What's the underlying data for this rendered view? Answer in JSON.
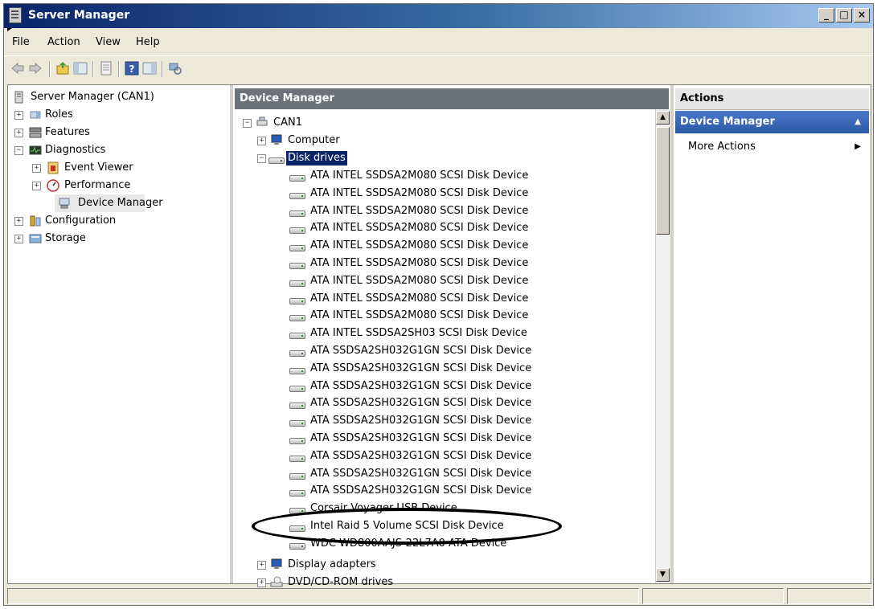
{
  "window": {
    "title": "Server Manager",
    "controls": [
      "_",
      "□",
      "×"
    ]
  },
  "menu": [
    "File",
    "Action",
    "View",
    "Help"
  ],
  "toolbar_icons": [
    "back-icon",
    "forward-icon",
    "up-folder-icon",
    "show-hide-tree-icon",
    "properties-icon",
    "help-icon",
    "show-hide-action-pane-icon",
    "scan-hardware-icon"
  ],
  "left_tree": {
    "root": "Server Manager (CAN1)",
    "items": [
      {
        "label": "Roles",
        "expander": "+"
      },
      {
        "label": "Features",
        "expander": "+"
      },
      {
        "label": "Diagnostics",
        "expander": "−"
      },
      {
        "label": "Event Viewer",
        "expander": "+"
      },
      {
        "label": "Performance",
        "expander": "+"
      },
      {
        "label": "Device Manager",
        "expander": ""
      },
      {
        "label": "Configuration",
        "expander": "+"
      },
      {
        "label": "Storage",
        "expander": "+"
      }
    ]
  },
  "middle": {
    "header": "Device Manager",
    "root": "CAN1",
    "computer": "Computer",
    "disk_drives": "Disk drives",
    "disks": [
      "ATA INTEL SSDSA2M080 SCSI Disk Device",
      "ATA INTEL SSDSA2M080 SCSI Disk Device",
      "ATA INTEL SSDSA2M080 SCSI Disk Device",
      "ATA INTEL SSDSA2M080 SCSI Disk Device",
      "ATA INTEL SSDSA2M080 SCSI Disk Device",
      "ATA INTEL SSDSA2M080 SCSI Disk Device",
      "ATA INTEL SSDSA2M080 SCSI Disk Device",
      "ATA INTEL SSDSA2M080 SCSI Disk Device",
      "ATA INTEL SSDSA2M080 SCSI Disk Device",
      "ATA INTEL SSDSA2SH03 SCSI Disk Device",
      "ATA SSDSA2SH032G1GN SCSI Disk Device",
      "ATA SSDSA2SH032G1GN SCSI Disk Device",
      "ATA SSDSA2SH032G1GN SCSI Disk Device",
      "ATA SSDSA2SH032G1GN SCSI Disk Device",
      "ATA SSDSA2SH032G1GN SCSI Disk Device",
      "ATA SSDSA2SH032G1GN SCSI Disk Device",
      "ATA SSDSA2SH032G1GN SCSI Disk Device",
      "ATA SSDSA2SH032G1GN SCSI Disk Device",
      "ATA SSDSA2SH032G1GN SCSI Disk Device",
      "Corsair Voyager USB Device",
      "Intel Raid 5 Volume SCSI Disk Device",
      "WDC WD800AAJS-22L7A0 ATA Device"
    ],
    "display_adapters": "Display adapters",
    "dvd_drives": "DVD/CD-ROM drives"
  },
  "actions": {
    "header": "Actions",
    "selected": "Device Manager",
    "more": "More Actions"
  }
}
